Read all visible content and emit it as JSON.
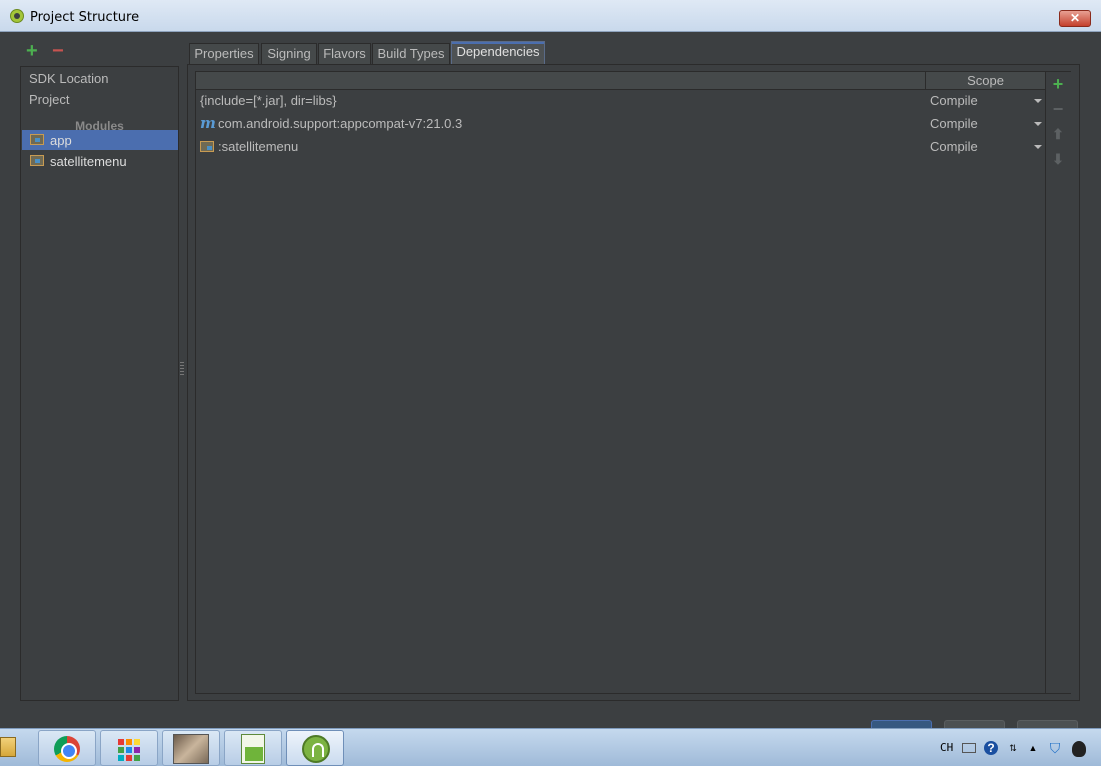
{
  "window": {
    "title": "Project Structure",
    "close_label": "✕"
  },
  "left_toolbar": {
    "add_icon": "plus-icon",
    "remove_icon": "minus-icon"
  },
  "nav": {
    "items": [
      {
        "label": "SDK Location"
      },
      {
        "label": "Project"
      }
    ],
    "modules_header": "Modules",
    "modules": [
      {
        "label": "app",
        "selected": true
      },
      {
        "label": "satellitemenu",
        "selected": false
      }
    ]
  },
  "tabs": [
    {
      "label": "Properties",
      "active": false
    },
    {
      "label": "Signing",
      "active": false
    },
    {
      "label": "Flavors",
      "active": false
    },
    {
      "label": "Build Types",
      "active": false
    },
    {
      "label": "Dependencies",
      "active": true
    }
  ],
  "dependencies": {
    "columns": {
      "name": "",
      "scope": "Scope"
    },
    "rows": [
      {
        "name": "{include=[*.jar], dir=libs}",
        "icon": "none",
        "scope": "Compile"
      },
      {
        "name": "com.android.support:appcompat-v7:21.0.3",
        "icon": "maven-m-icon",
        "scope": "Compile"
      },
      {
        "name": ":satellitemenu",
        "icon": "module-folder-icon",
        "scope": "Compile"
      }
    ],
    "maven_glyph": "m"
  },
  "side_toolbar": {
    "add": "+",
    "remove": "−",
    "up": "⬆",
    "down": "⬇"
  },
  "taskbar": {
    "tray_lang": "CH",
    "tray_help": "?",
    "tray_up": "▲"
  },
  "colors": {
    "background": "#3c3f41",
    "selection": "#4b6eaf",
    "add_green": "#4caf50",
    "remove_red": "#c75450"
  }
}
